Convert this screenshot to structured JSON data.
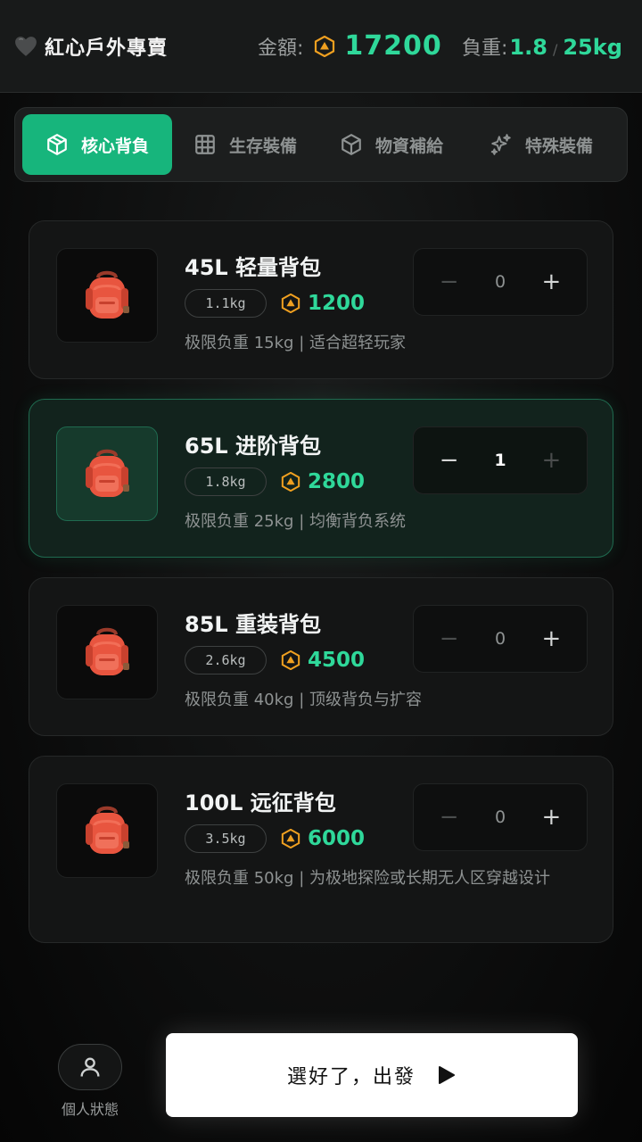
{
  "header": {
    "brand_title": "紅心戶外專賣",
    "money_label": "金額:",
    "money_value": "17200",
    "weight_label": "負重:",
    "weight_current": "1.8",
    "weight_sep": "/",
    "weight_max": "25kg"
  },
  "tabs": [
    {
      "label": "核心背負",
      "icon": "cube-icon",
      "active": true
    },
    {
      "label": "生存裝備",
      "icon": "grid-icon",
      "active": false
    },
    {
      "label": "物資補給",
      "icon": "box-icon",
      "active": false
    },
    {
      "label": "特殊裝備",
      "icon": "sparkles-icon",
      "active": false
    }
  ],
  "items": [
    {
      "title": "45L 轻量背包",
      "weight": "1.1kg",
      "price": "1200",
      "desc": "极限负重 15kg | 适合超轻玩家",
      "qty": "0",
      "selected": false
    },
    {
      "title": "65L 进阶背包",
      "weight": "1.8kg",
      "price": "2800",
      "desc": "极限负重 25kg | 均衡背负系统",
      "qty": "1",
      "selected": true
    },
    {
      "title": "85L 重装背包",
      "weight": "2.6kg",
      "price": "4500",
      "desc": "极限负重 40kg | 顶级背负与扩容",
      "qty": "0",
      "selected": false
    },
    {
      "title": "100L 远征背包",
      "weight": "3.5kg",
      "price": "6000",
      "desc": "极限负重 50kg | 为极地探险或长期无人区穿越设计",
      "qty": "0",
      "selected": false
    }
  ],
  "stepper": {
    "minus": "−",
    "plus": "+"
  },
  "bottom": {
    "profile_label": "個人狀態",
    "go_label": "選好了，出發"
  },
  "colors": {
    "accent": "#17b57c",
    "money": "#2fd89a",
    "coin": "#f0a020"
  }
}
